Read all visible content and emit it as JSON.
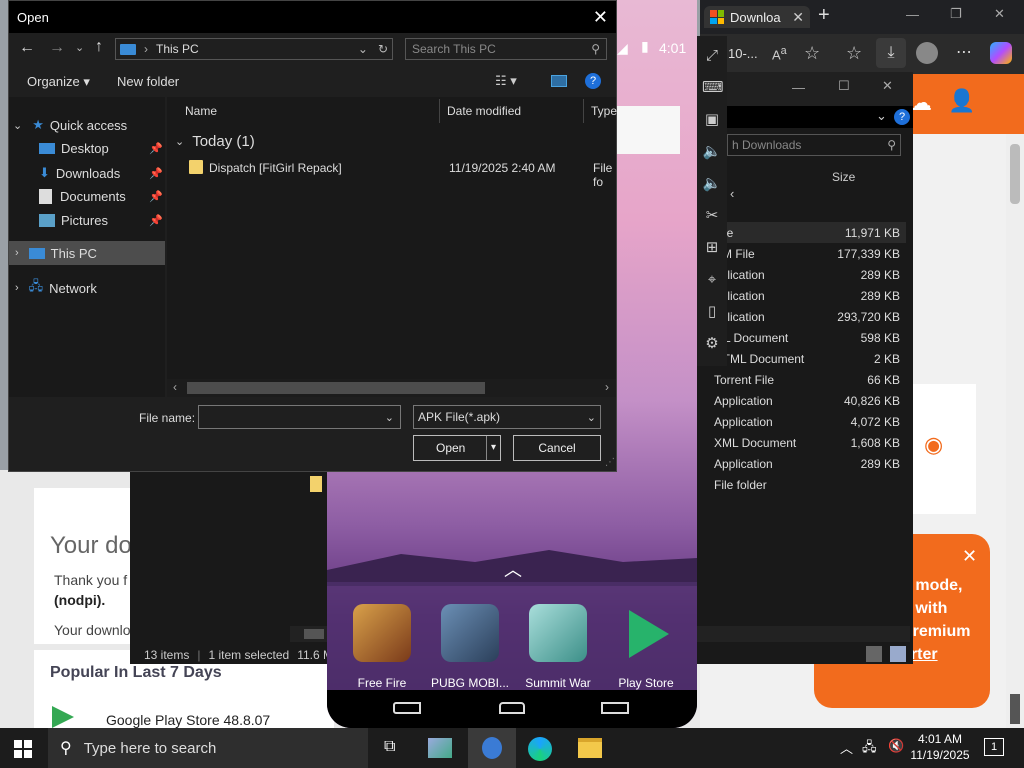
{
  "dialog": {
    "title": "Open",
    "address": "This PC",
    "search_placeholder": "Search This PC",
    "organize": "Organize",
    "new_folder": "New folder",
    "columns": {
      "name": "Name",
      "date": "Date modified",
      "type": "Type"
    },
    "group": "Today (1)",
    "files": [
      {
        "name": "Dispatch [FitGirl Repack]",
        "date": "11/19/2025 2:40 AM",
        "type": "File fo"
      }
    ],
    "nav": {
      "quick_access": "Quick access",
      "desktop": "Desktop",
      "downloads": "Downloads",
      "documents": "Documents",
      "pictures": "Pictures",
      "this_pc": "This PC",
      "network": "Network"
    },
    "filename_label": "File name:",
    "filename_value": "",
    "filetype": "APK File(*.apk)",
    "open": "Open",
    "cancel": "Cancel"
  },
  "browser": {
    "tab_title": "Downloa",
    "url_fragment": "10-...",
    "website": {
      "heading": "Your do",
      "thank_you": "Thank you f",
      "nodpi": "(nodpi).",
      "your_download": "Your downlo",
      "popular": "Popular In Last 7 Days",
      "popular_item": "Google Play Store 48.8.07",
      "promo_line1": "k mode,",
      "promo_line2": "e with",
      "promo_line3": "Premium",
      "promo_link": "arter"
    }
  },
  "emulator": {
    "time": "4:01",
    "apps": [
      {
        "label": "Free Fire"
      },
      {
        "label": "PUBG MOBI..."
      },
      {
        "label": "Summit War"
      },
      {
        "label": "Play Store"
      }
    ]
  },
  "file_manager": {
    "search_placeholder": "h Downloads",
    "size_header": "Size",
    "rows": [
      {
        "type": "File",
        "size": "11,971 KB"
      },
      {
        "type": "KM File",
        "size": "177,339 KB"
      },
      {
        "type": "pplication",
        "size": "289 KB"
      },
      {
        "type": "pplication",
        "size": "289 KB"
      },
      {
        "type": "pplication",
        "size": "293,720 KB"
      },
      {
        "type": "ML Document",
        "size": "598 KB"
      },
      {
        "type": "HTML Document",
        "size": "2 KB"
      },
      {
        "type": "Torrent File",
        "size": "66 KB"
      },
      {
        "type": "Application",
        "size": "40,826 KB"
      },
      {
        "type": "Application",
        "size": "4,072 KB"
      },
      {
        "type": "XML Document",
        "size": "1,608 KB"
      },
      {
        "type": "Application",
        "size": "289 KB"
      },
      {
        "type": "File folder",
        "size": ""
      }
    ],
    "status_items": "13 items",
    "status_selected": "1 item selected",
    "status_size": "11.6 M"
  },
  "taskbar": {
    "search_placeholder": "Type here to search",
    "time": "4:01 AM",
    "date": "11/19/2025",
    "notification_count": "1"
  }
}
